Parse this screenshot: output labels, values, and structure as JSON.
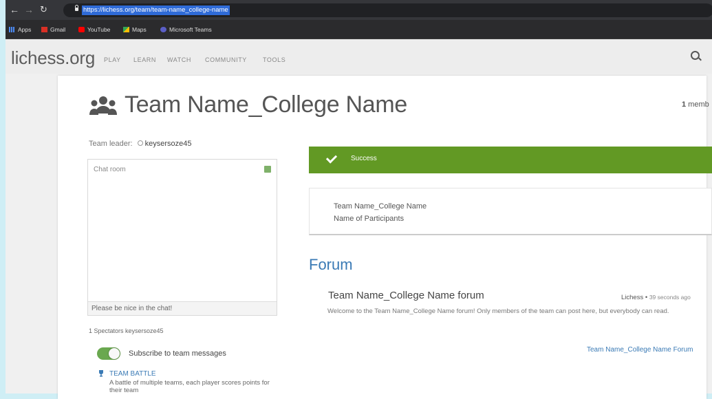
{
  "browser": {
    "url": "https://lichess.org/team/team-name_college-name",
    "bookmarks": [
      {
        "label": "Apps",
        "color": "#4c8bf5"
      },
      {
        "label": "Gmail",
        "color": "#d93025"
      },
      {
        "label": "YouTube",
        "color": "#ff0000"
      },
      {
        "label": "Maps",
        "color": "#34a853"
      },
      {
        "label": "Microsoft Teams",
        "color": "#5b5fc7"
      }
    ]
  },
  "site": {
    "logo": "lichess.org",
    "nav": [
      "PLAY",
      "LEARN",
      "WATCH",
      "COMMUNITY",
      "TOOLS"
    ]
  },
  "team": {
    "name": "Team Name_College Name",
    "members_count": "1",
    "members_label": "memb",
    "leader_label": "Team leader:",
    "leader_name": "keysersoze45"
  },
  "chat": {
    "title": "Chat room",
    "placeholder": "Please be nice in the chat!",
    "spectators": "1 Spectators keysersoze45"
  },
  "subscribe": {
    "label": "Subscribe to team messages",
    "enabled": true
  },
  "team_battle": {
    "title": "TEAM BATTLE",
    "description": "A battle of multiple teams, each player scores points for their team"
  },
  "flash": {
    "text": "Success",
    "color": "#629924"
  },
  "description": [
    "Team Name_College Name",
    "Name of Participants"
  ],
  "forum": {
    "heading": "Forum",
    "topic_title": "Team Name_College Name forum",
    "topic_author": "Lichess",
    "topic_time": "39 seconds ago",
    "topic_body": "Welcome to the Team Name_College Name forum! Only members of the team can post here, but everybody can read.",
    "link": "Team Name_College Name Forum"
  }
}
